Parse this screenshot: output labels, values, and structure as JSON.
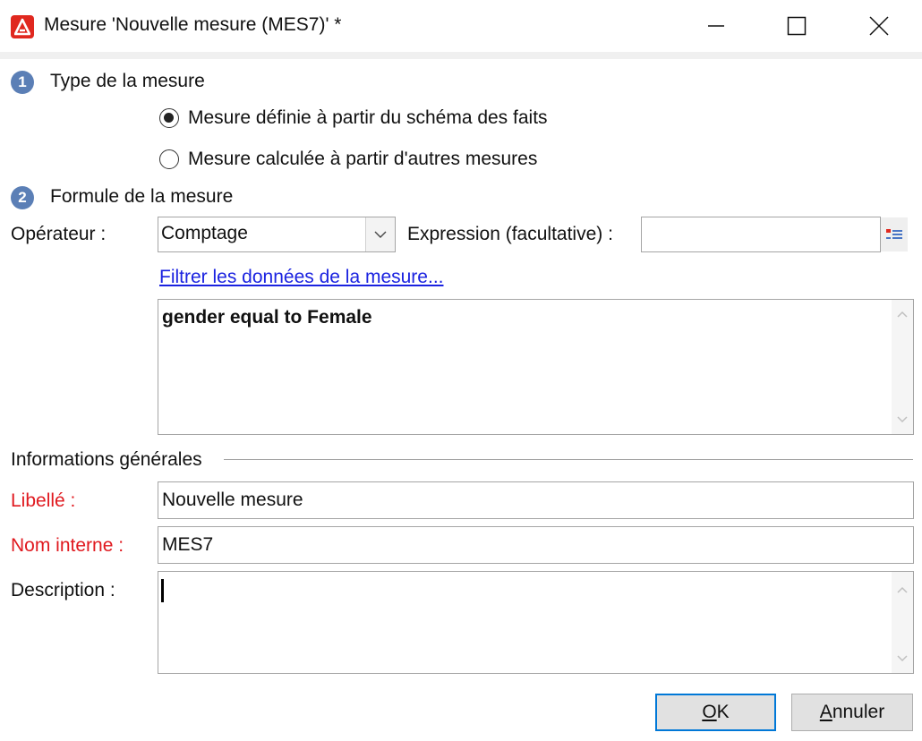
{
  "window": {
    "title": "Mesure 'Nouvelle mesure (MES7)' *"
  },
  "section1": {
    "number": "1",
    "title": "Type de la mesure",
    "options": [
      {
        "label": "Mesure définie à partir du schéma des faits",
        "selected": true
      },
      {
        "label": "Mesure calculée à partir d'autres mesures",
        "selected": false
      }
    ]
  },
  "section2": {
    "number": "2",
    "title": "Formule de la mesure",
    "operator_label": "Opérateur :",
    "operator_value": "Comptage",
    "expression_label": "Expression (facultative) :",
    "expression_value": "",
    "filter_link": "Filtrer les données de la mesure...",
    "filter_text": "gender equal to Female"
  },
  "general": {
    "title": "Informations générales",
    "label_label": "Libellé :",
    "label_value": "Nouvelle mesure",
    "internal_name_label": "Nom interne :",
    "internal_name_value": "MES7",
    "description_label": "Description :",
    "description_value": ""
  },
  "buttons": {
    "ok_prefix": "",
    "ok_u": "O",
    "ok_rest": "K",
    "cancel_u": "A",
    "cancel_rest": "nnuler"
  },
  "colors": {
    "accent": "#0078d7",
    "required_label": "#e0191f",
    "link": "#1a22e0",
    "step_badge": "#5b7fb6",
    "app_icon": "#e0281f"
  }
}
